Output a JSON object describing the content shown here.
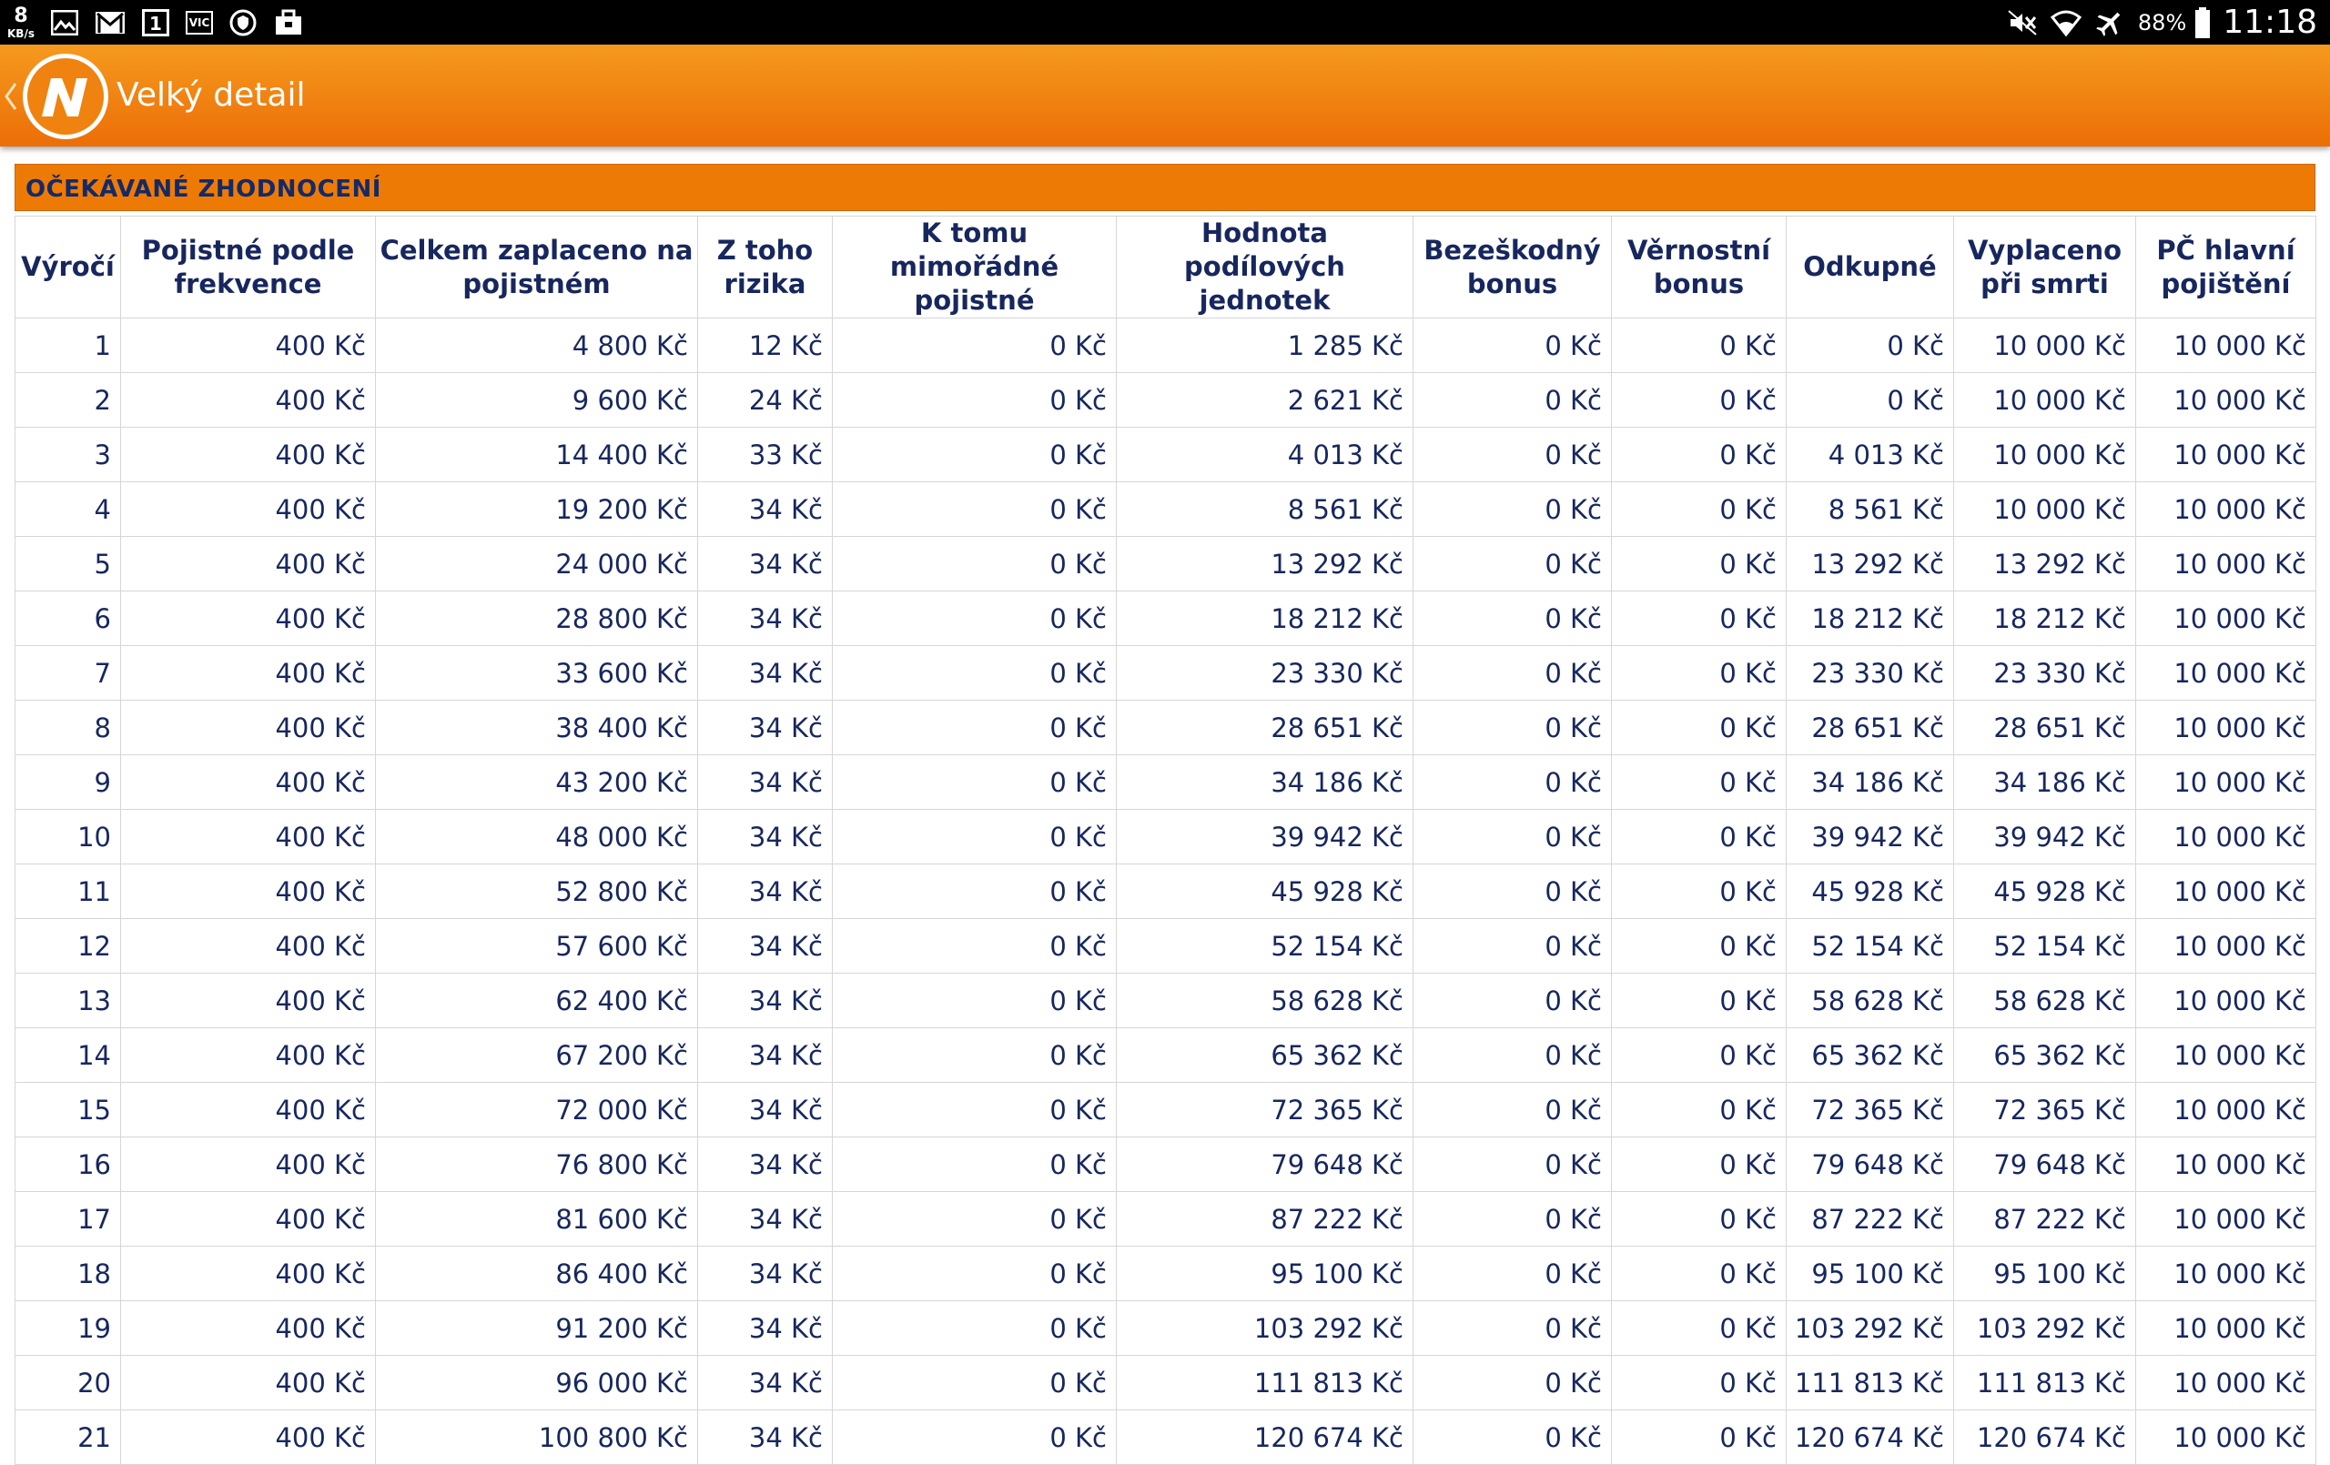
{
  "status_bar": {
    "net_speed": "8",
    "net_speed_unit": "KB/s",
    "notification_digit": "1",
    "vlc_label": "VIC",
    "battery": "88%",
    "time": "11:18"
  },
  "app_bar": {
    "title": "Velký detail"
  },
  "section": {
    "title": "OČEKÁVANÉ ZHODNOCENÍ"
  },
  "table": {
    "columns": [
      "Výročí",
      "Pojistné podle frekvence",
      "Celkem zaplaceno na pojistném",
      "Z toho rizika",
      "K tomu mimořádné pojistné",
      "Hodnota podílových jednotek",
      "Bezeškodný bonus",
      "Věrnostní bonus",
      "Odkupné",
      "Vyplaceno při smrti",
      "PČ hlavní pojištění"
    ],
    "rows": [
      [
        "1",
        "400 Kč",
        "4 800 Kč",
        "12 Kč",
        "0 Kč",
        "1 285 Kč",
        "0 Kč",
        "0 Kč",
        "0 Kč",
        "10 000 Kč",
        "10 000 Kč"
      ],
      [
        "2",
        "400 Kč",
        "9 600 Kč",
        "24 Kč",
        "0 Kč",
        "2 621 Kč",
        "0 Kč",
        "0 Kč",
        "0 Kč",
        "10 000 Kč",
        "10 000 Kč"
      ],
      [
        "3",
        "400 Kč",
        "14 400 Kč",
        "33 Kč",
        "0 Kč",
        "4 013 Kč",
        "0 Kč",
        "0 Kč",
        "4 013 Kč",
        "10 000 Kč",
        "10 000 Kč"
      ],
      [
        "4",
        "400 Kč",
        "19 200 Kč",
        "34 Kč",
        "0 Kč",
        "8 561 Kč",
        "0 Kč",
        "0 Kč",
        "8 561 Kč",
        "10 000 Kč",
        "10 000 Kč"
      ],
      [
        "5",
        "400 Kč",
        "24 000 Kč",
        "34 Kč",
        "0 Kč",
        "13 292 Kč",
        "0 Kč",
        "0 Kč",
        "13 292 Kč",
        "13 292 Kč",
        "10 000 Kč"
      ],
      [
        "6",
        "400 Kč",
        "28 800 Kč",
        "34 Kč",
        "0 Kč",
        "18 212 Kč",
        "0 Kč",
        "0 Kč",
        "18 212 Kč",
        "18 212 Kč",
        "10 000 Kč"
      ],
      [
        "7",
        "400 Kč",
        "33 600 Kč",
        "34 Kč",
        "0 Kč",
        "23 330 Kč",
        "0 Kč",
        "0 Kč",
        "23 330 Kč",
        "23 330 Kč",
        "10 000 Kč"
      ],
      [
        "8",
        "400 Kč",
        "38 400 Kč",
        "34 Kč",
        "0 Kč",
        "28 651 Kč",
        "0 Kč",
        "0 Kč",
        "28 651 Kč",
        "28 651 Kč",
        "10 000 Kč"
      ],
      [
        "9",
        "400 Kč",
        "43 200 Kč",
        "34 Kč",
        "0 Kč",
        "34 186 Kč",
        "0 Kč",
        "0 Kč",
        "34 186 Kč",
        "34 186 Kč",
        "10 000 Kč"
      ],
      [
        "10",
        "400 Kč",
        "48 000 Kč",
        "34 Kč",
        "0 Kč",
        "39 942 Kč",
        "0 Kč",
        "0 Kč",
        "39 942 Kč",
        "39 942 Kč",
        "10 000 Kč"
      ],
      [
        "11",
        "400 Kč",
        "52 800 Kč",
        "34 Kč",
        "0 Kč",
        "45 928 Kč",
        "0 Kč",
        "0 Kč",
        "45 928 Kč",
        "45 928 Kč",
        "10 000 Kč"
      ],
      [
        "12",
        "400 Kč",
        "57 600 Kč",
        "34 Kč",
        "0 Kč",
        "52 154 Kč",
        "0 Kč",
        "0 Kč",
        "52 154 Kč",
        "52 154 Kč",
        "10 000 Kč"
      ],
      [
        "13",
        "400 Kč",
        "62 400 Kč",
        "34 Kč",
        "0 Kč",
        "58 628 Kč",
        "0 Kč",
        "0 Kč",
        "58 628 Kč",
        "58 628 Kč",
        "10 000 Kč"
      ],
      [
        "14",
        "400 Kč",
        "67 200 Kč",
        "34 Kč",
        "0 Kč",
        "65 362 Kč",
        "0 Kč",
        "0 Kč",
        "65 362 Kč",
        "65 362 Kč",
        "10 000 Kč"
      ],
      [
        "15",
        "400 Kč",
        "72 000 Kč",
        "34 Kč",
        "0 Kč",
        "72 365 Kč",
        "0 Kč",
        "0 Kč",
        "72 365 Kč",
        "72 365 Kč",
        "10 000 Kč"
      ],
      [
        "16",
        "400 Kč",
        "76 800 Kč",
        "34 Kč",
        "0 Kč",
        "79 648 Kč",
        "0 Kč",
        "0 Kč",
        "79 648 Kč",
        "79 648 Kč",
        "10 000 Kč"
      ],
      [
        "17",
        "400 Kč",
        "81 600 Kč",
        "34 Kč",
        "0 Kč",
        "87 222 Kč",
        "0 Kč",
        "0 Kč",
        "87 222 Kč",
        "87 222 Kč",
        "10 000 Kč"
      ],
      [
        "18",
        "400 Kč",
        "86 400 Kč",
        "34 Kč",
        "0 Kč",
        "95 100 Kč",
        "0 Kč",
        "0 Kč",
        "95 100 Kč",
        "95 100 Kč",
        "10 000 Kč"
      ],
      [
        "19",
        "400 Kč",
        "91 200 Kč",
        "34 Kč",
        "0 Kč",
        "103 292 Kč",
        "0 Kč",
        "0 Kč",
        "103 292 Kč",
        "103 292 Kč",
        "10 000 Kč"
      ],
      [
        "20",
        "400 Kč",
        "96 000 Kč",
        "34 Kč",
        "0 Kč",
        "111 813 Kč",
        "0 Kč",
        "0 Kč",
        "111 813 Kč",
        "111 813 Kč",
        "10 000 Kč"
      ],
      [
        "21",
        "400 Kč",
        "100 800 Kč",
        "34 Kč",
        "0 Kč",
        "120 674 Kč",
        "0 Kč",
        "0 Kč",
        "120 674 Kč",
        "120 674 Kč",
        "10 000 Kč"
      ]
    ]
  },
  "colors": {
    "status_bar_bg": "#000000",
    "app_bar_orange": "#ec6e07",
    "section_orange": "#ee7a06",
    "text_navy": "#17275e",
    "grid_line": "#d6d6d6"
  }
}
